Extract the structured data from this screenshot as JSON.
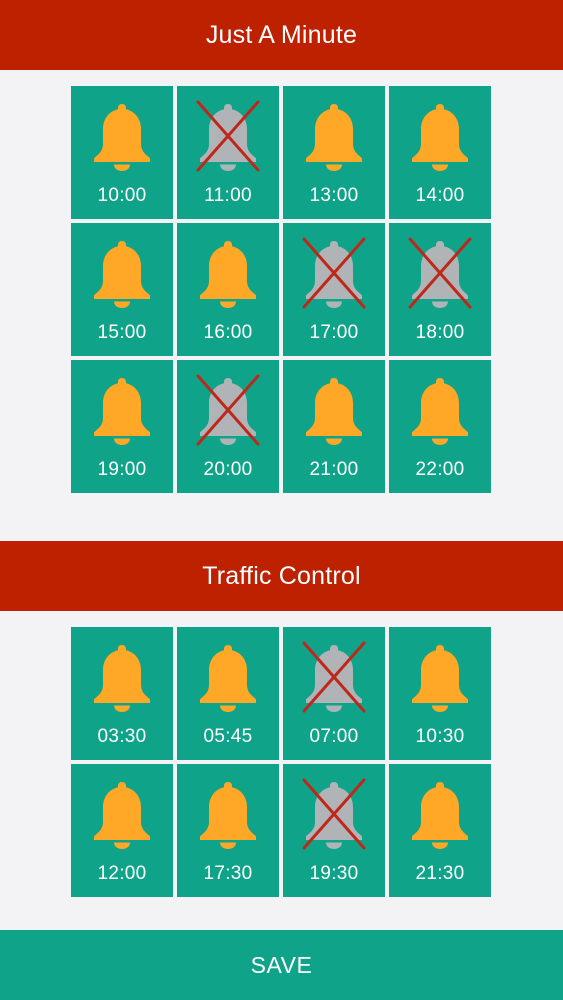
{
  "colors": {
    "header_bg": "#bd2100",
    "tile_bg": "#0fa489",
    "bell_on": "#ffa726",
    "bell_off": "#b0b4b6",
    "cross": "#c0271b",
    "save_bg": "#0fa489",
    "page_bg": "#f3f3f5"
  },
  "sections": [
    {
      "title": "Just A Minute",
      "alarms": [
        {
          "time": "10:00",
          "enabled": true,
          "icon": "bell-icon"
        },
        {
          "time": "11:00",
          "enabled": false,
          "icon": "bell-off-icon"
        },
        {
          "time": "13:00",
          "enabled": true,
          "icon": "bell-icon"
        },
        {
          "time": "14:00",
          "enabled": true,
          "icon": "bell-icon"
        },
        {
          "time": "15:00",
          "enabled": true,
          "icon": "bell-icon"
        },
        {
          "time": "16:00",
          "enabled": true,
          "icon": "bell-icon"
        },
        {
          "time": "17:00",
          "enabled": false,
          "icon": "bell-off-icon"
        },
        {
          "time": "18:00",
          "enabled": false,
          "icon": "bell-off-icon"
        },
        {
          "time": "19:00",
          "enabled": true,
          "icon": "bell-icon"
        },
        {
          "time": "20:00",
          "enabled": false,
          "icon": "bell-off-icon"
        },
        {
          "time": "21:00",
          "enabled": true,
          "icon": "bell-icon"
        },
        {
          "time": "22:00",
          "enabled": true,
          "icon": "bell-icon"
        }
      ]
    },
    {
      "title": "Traffic Control",
      "alarms": [
        {
          "time": "03:30",
          "enabled": true,
          "icon": "bell-icon"
        },
        {
          "time": "05:45",
          "enabled": true,
          "icon": "bell-icon"
        },
        {
          "time": "07:00",
          "enabled": false,
          "icon": "bell-off-icon"
        },
        {
          "time": "10:30",
          "enabled": true,
          "icon": "bell-icon"
        },
        {
          "time": "12:00",
          "enabled": true,
          "icon": "bell-icon"
        },
        {
          "time": "17:30",
          "enabled": true,
          "icon": "bell-icon"
        },
        {
          "time": "19:30",
          "enabled": false,
          "icon": "bell-off-icon"
        },
        {
          "time": "21:30",
          "enabled": true,
          "icon": "bell-icon"
        }
      ]
    }
  ],
  "save_label": "SAVE"
}
